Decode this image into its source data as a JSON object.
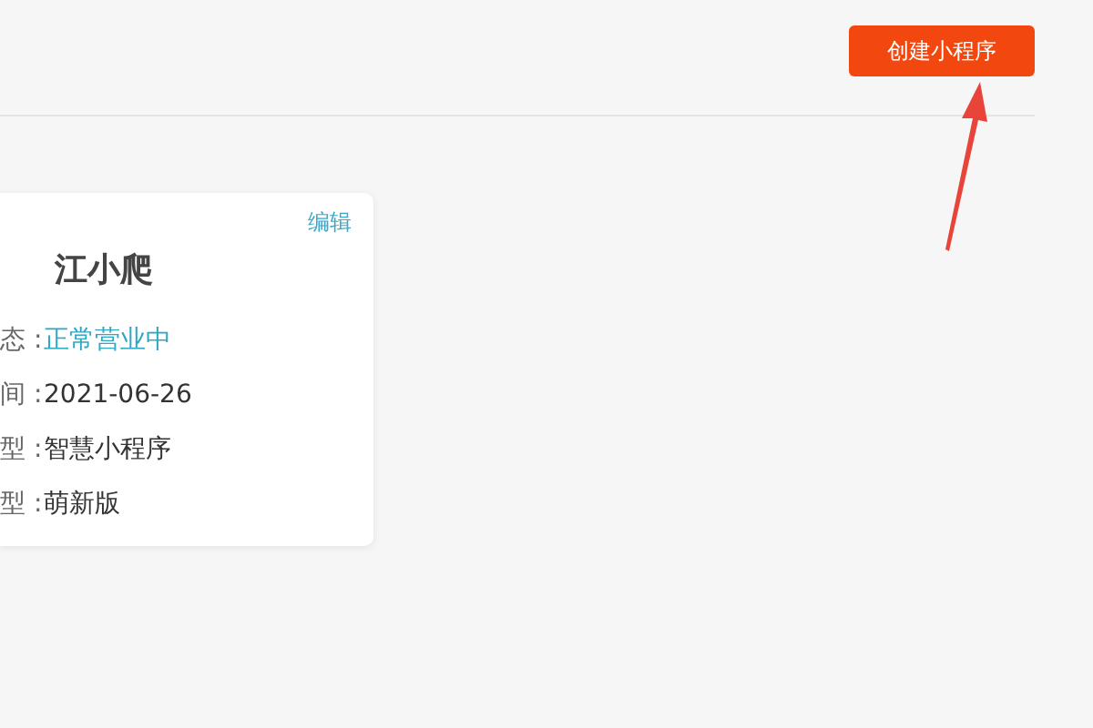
{
  "header": {
    "create_button": "创建小程序"
  },
  "card": {
    "edit_link": "编辑",
    "title": "江小爬",
    "rows": [
      {
        "kind": "status",
        "label": "态 :",
        "value": "正常营业中"
      },
      {
        "kind": "text",
        "label": "间 :",
        "value": "2021-06-26"
      },
      {
        "kind": "text",
        "label": "型 :",
        "value": "智慧小程序"
      },
      {
        "kind": "text",
        "label": "型 :",
        "value": "萌新版"
      }
    ]
  }
}
